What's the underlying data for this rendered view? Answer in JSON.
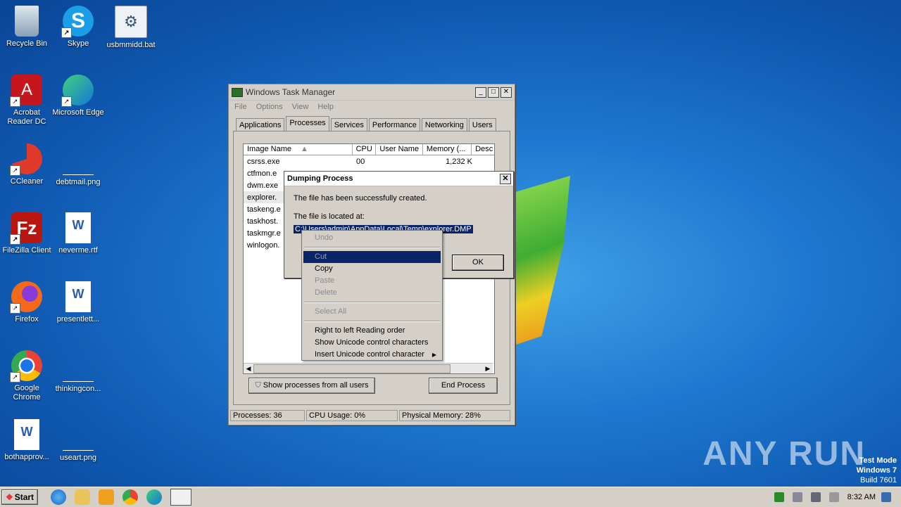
{
  "desktop": {
    "icons": [
      {
        "label": "Recycle Bin",
        "icon": "recycle-bin-icon"
      },
      {
        "label": "Skype",
        "icon": "skype-icon"
      },
      {
        "label": "usbmmidd.bat",
        "icon": "bat-file-icon"
      },
      {
        "label": "Acrobat Reader DC",
        "icon": "acrobat-icon"
      },
      {
        "label": "Microsoft Edge",
        "icon": "edge-icon"
      },
      {
        "label": "CCleaner",
        "icon": "ccleaner-icon"
      },
      {
        "label": "debtmail.png",
        "icon": "png-file-icon"
      },
      {
        "label": "FileZilla Client",
        "icon": "filezilla-icon"
      },
      {
        "label": "neverme.rtf",
        "icon": "word-doc-icon"
      },
      {
        "label": "Firefox",
        "icon": "firefox-icon"
      },
      {
        "label": "presentlett...",
        "icon": "word-doc-icon"
      },
      {
        "label": "Google Chrome",
        "icon": "chrome-icon"
      },
      {
        "label": "thinkingcon...",
        "icon": "png-file-icon"
      },
      {
        "label": "bothapprov...",
        "icon": "word-doc-icon"
      },
      {
        "label": "useart.png",
        "icon": "png-file-icon"
      }
    ],
    "watermark": "ANY RUN",
    "test_mode": {
      "line1": "Test Mode",
      "line2": "Windows 7",
      "line3": "Build 7601"
    }
  },
  "task_manager": {
    "title": "Windows Task Manager",
    "menu": [
      "File",
      "Options",
      "View",
      "Help"
    ],
    "tabs": [
      "Applications",
      "Processes",
      "Services",
      "Performance",
      "Networking",
      "Users"
    ],
    "active_tab": "Processes",
    "columns": [
      "Image Name",
      "CPU",
      "User Name",
      "Memory (...",
      "Desc"
    ],
    "rows": [
      {
        "name": "csrss.exe",
        "cpu": "00",
        "mem": "1,232 K"
      },
      {
        "name": "ctfmon.e",
        "cpu": "",
        "mem": ""
      },
      {
        "name": "dwm.exe",
        "cpu": "",
        "mem": ""
      },
      {
        "name": "explorer.",
        "cpu": "",
        "mem": ""
      },
      {
        "name": "taskeng.e",
        "cpu": "",
        "mem": ""
      },
      {
        "name": "taskhost.",
        "cpu": "",
        "mem": ""
      },
      {
        "name": "taskmgr.e",
        "cpu": "",
        "mem": ""
      },
      {
        "name": "winlogon.",
        "cpu": "",
        "mem": ""
      }
    ],
    "show_all_label": "Show processes from all users",
    "end_process_label": "End Process",
    "status": {
      "processes": "Processes: 36",
      "cpu": "CPU Usage: 0%",
      "memory": "Physical Memory: 28%"
    }
  },
  "dialog": {
    "title": "Dumping Process",
    "line1": "The file has been successfully created.",
    "line2": "The file is located at:",
    "path": "C:\\Users\\admin\\AppData\\Local\\Temp\\explorer.DMP",
    "ok_label": "OK"
  },
  "context_menu": {
    "undo": "Undo",
    "cut": "Cut",
    "copy": "Copy",
    "paste": "Paste",
    "delete": "Delete",
    "select_all": "Select All",
    "rtl": "Right to left Reading order",
    "show_unicode": "Show Unicode control characters",
    "insert_unicode": "Insert Unicode control character"
  },
  "taskbar": {
    "start_label": "Start",
    "clock": "8:32 AM"
  }
}
